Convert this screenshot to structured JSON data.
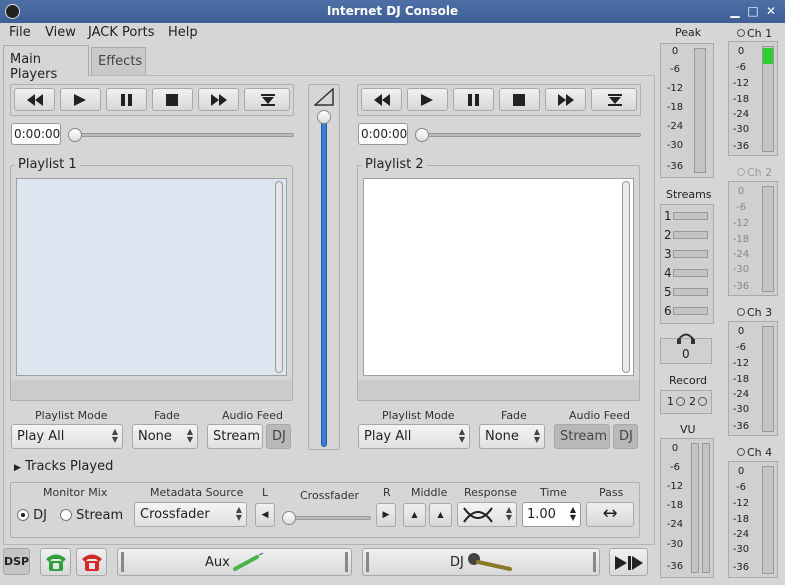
{
  "window": {
    "title": "Internet DJ Console"
  },
  "menu": {
    "items": [
      "File",
      "View",
      "JACK Ports",
      "Help"
    ]
  },
  "tabs": [
    {
      "label": "Main Players"
    },
    {
      "label": "Effects"
    }
  ],
  "player1": {
    "time": "0:00:00",
    "playlist_title": "Playlist 1",
    "playlist_mode_label": "Playlist Mode",
    "playlist_mode": "Play All",
    "fade_label": "Fade",
    "fade": "None",
    "audio_feed_label": "Audio Feed",
    "stream_btn": "Stream",
    "dj_btn": "DJ"
  },
  "player2": {
    "time": "0:00:00",
    "playlist_title": "Playlist 2",
    "playlist_mode_label": "Playlist Mode",
    "playlist_mode": "Play All",
    "fade_label": "Fade",
    "fade": "None",
    "audio_feed_label": "Audio Feed",
    "stream_btn": "Stream",
    "dj_btn": "DJ"
  },
  "tracks_played": "Tracks Played",
  "bottom": {
    "monitor_mix_label": "Monitor Mix",
    "monitor_dj": "DJ",
    "monitor_stream": "Stream",
    "metadata_label": "Metadata Source",
    "metadata_value": "Crossfader",
    "l_label": "L",
    "crossfader_label": "Crossfader",
    "r_label": "R",
    "middle_label": "Middle",
    "response_label": "Response",
    "time_label": "Time",
    "time_value": "1.00",
    "pass_label": "Pass"
  },
  "footer": {
    "dsp": "DSP",
    "aux": "Aux",
    "dj": "DJ"
  },
  "meters": {
    "peak_title": "Peak",
    "scale": [
      "0",
      "-6",
      "-12",
      "-18",
      "-24",
      "-30",
      "-36"
    ],
    "streams_title": "Streams",
    "streams": [
      "1",
      "2",
      "3",
      "4",
      "5",
      "6"
    ],
    "listeners": "0",
    "record_title": "Record",
    "record_items": [
      "1",
      "2"
    ],
    "vu_title": "VU",
    "channels": [
      {
        "label": "Ch 1"
      },
      {
        "label": "Ch 2"
      },
      {
        "label": "Ch 3"
      },
      {
        "label": "Ch 4"
      }
    ]
  }
}
